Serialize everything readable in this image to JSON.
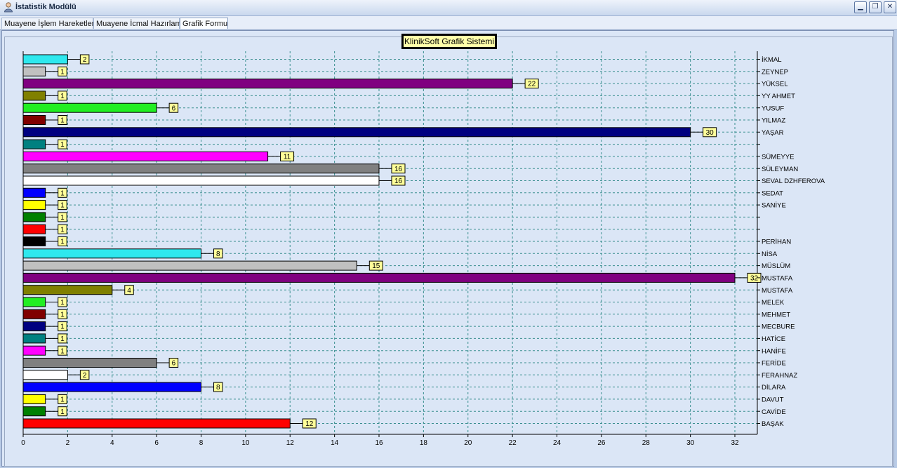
{
  "window": {
    "title": "İstatistik Modülü",
    "minimize_icon": "minimize-icon",
    "restore_icon": "restore-icon",
    "close_icon": "close-icon"
  },
  "tabs": [
    {
      "label": "Muayene İşlem Hareketleri",
      "active": false
    },
    {
      "label": "Muayene İcmal Hazırlama",
      "active": false
    },
    {
      "label": "Grafik Formu",
      "active": true
    }
  ],
  "chart_data": {
    "type": "bar",
    "orientation": "horizontal",
    "title": "KlinikSoft Grafik Sistemi",
    "xlim": [
      0,
      33
    ],
    "x_ticks": [
      0,
      2,
      4,
      6,
      8,
      10,
      12,
      14,
      16,
      18,
      20,
      22,
      24,
      26,
      28,
      30,
      32
    ],
    "grid": true,
    "data_labels": true,
    "categories": [
      "İKMAL",
      "ZEYNEP",
      "YÜKSEL",
      "YY AHMET",
      "YUSUF",
      "YILMAZ",
      "YAŞAR",
      "",
      "SÜMEYYE",
      "SÜLEYMAN",
      "SEVAL DZHFEROVA",
      "SEDAT",
      "SANİYE",
      "",
      "",
      "PERİHAN",
      "NİSA",
      "MÜSLÜM",
      "MUSTAFA",
      "MUSTAFA",
      "MELEK",
      "MEHMET",
      "MECBURE",
      "HATİCE",
      "HANİFE",
      "FERİDE",
      "FERAHNAZ",
      "DİLARA",
      "DAVUT",
      "CAVİDE",
      "BAŞAK"
    ],
    "values": [
      2,
      1,
      22,
      1,
      6,
      1,
      30,
      1,
      11,
      16,
      16,
      1,
      1,
      1,
      1,
      1,
      8,
      15,
      32,
      4,
      1,
      1,
      1,
      1,
      1,
      6,
      2,
      8,
      1,
      1,
      12
    ],
    "colors": [
      "#2ee8ee",
      "#c0c0c0",
      "#800080",
      "#808000",
      "#22ee22",
      "#800000",
      "#000080",
      "#008080",
      "#ff00ff",
      "#808080",
      "#ffffff",
      "#0000ff",
      "#ffff00",
      "#008000",
      "#ff0000",
      "#000000",
      "#2ee8ee",
      "#c0c0c0",
      "#800080",
      "#808000",
      "#22ee22",
      "#800000",
      "#000080",
      "#008080",
      "#ff00ff",
      "#808080",
      "#ffffff",
      "#0000ff",
      "#ffff00",
      "#008000",
      "#ff0000"
    ]
  }
}
